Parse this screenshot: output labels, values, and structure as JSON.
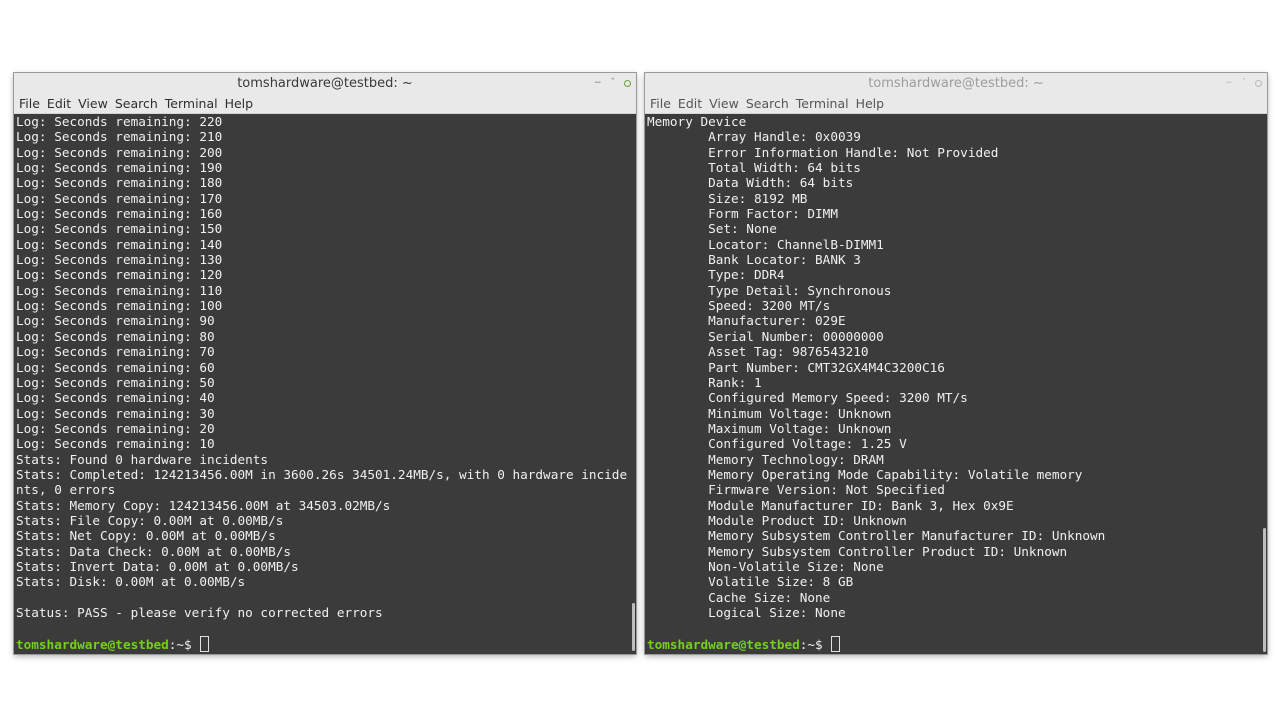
{
  "left_window": {
    "title": "tomshardware@testbed: ~",
    "menu": [
      "File",
      "Edit",
      "View",
      "Search",
      "Terminal",
      "Help"
    ],
    "lines": [
      "Log: Seconds remaining: 220",
      "Log: Seconds remaining: 210",
      "Log: Seconds remaining: 200",
      "Log: Seconds remaining: 190",
      "Log: Seconds remaining: 180",
      "Log: Seconds remaining: 170",
      "Log: Seconds remaining: 160",
      "Log: Seconds remaining: 150",
      "Log: Seconds remaining: 140",
      "Log: Seconds remaining: 130",
      "Log: Seconds remaining: 120",
      "Log: Seconds remaining: 110",
      "Log: Seconds remaining: 100",
      "Log: Seconds remaining: 90",
      "Log: Seconds remaining: 80",
      "Log: Seconds remaining: 70",
      "Log: Seconds remaining: 60",
      "Log: Seconds remaining: 50",
      "Log: Seconds remaining: 40",
      "Log: Seconds remaining: 30",
      "Log: Seconds remaining: 20",
      "Log: Seconds remaining: 10",
      "Stats: Found 0 hardware incidents",
      "Stats: Completed: 124213456.00M in 3600.26s 34501.24MB/s, with 0 hardware incide",
      "nts, 0 errors",
      "Stats: Memory Copy: 124213456.00M at 34503.02MB/s",
      "Stats: File Copy: 0.00M at 0.00MB/s",
      "Stats: Net Copy: 0.00M at 0.00MB/s",
      "Stats: Data Check: 0.00M at 0.00MB/s",
      "Stats: Invert Data: 0.00M at 0.00MB/s",
      "Stats: Disk: 0.00M at 0.00MB/s",
      "",
      "Status: PASS - please verify no corrected errors",
      ""
    ],
    "prompt_user": "tomshardware@testbed",
    "prompt_path": ":~$ "
  },
  "right_window": {
    "title": "tomshardware@testbed: ~",
    "menu": [
      "File",
      "Edit",
      "View",
      "Search",
      "Terminal",
      "Help"
    ],
    "lines": [
      "Memory Device",
      "        Array Handle: 0x0039",
      "        Error Information Handle: Not Provided",
      "        Total Width: 64 bits",
      "        Data Width: 64 bits",
      "        Size: 8192 MB",
      "        Form Factor: DIMM",
      "        Set: None",
      "        Locator: ChannelB-DIMM1",
      "        Bank Locator: BANK 3",
      "        Type: DDR4",
      "        Type Detail: Synchronous",
      "        Speed: 3200 MT/s",
      "        Manufacturer: 029E",
      "        Serial Number: 00000000",
      "        Asset Tag: 9876543210",
      "        Part Number: CMT32GX4M4C3200C16",
      "        Rank: 1",
      "        Configured Memory Speed: 3200 MT/s",
      "        Minimum Voltage: Unknown",
      "        Maximum Voltage: Unknown",
      "        Configured Voltage: 1.25 V",
      "        Memory Technology: DRAM",
      "        Memory Operating Mode Capability: Volatile memory",
      "        Firmware Version: Not Specified",
      "        Module Manufacturer ID: Bank 3, Hex 0x9E",
      "        Module Product ID: Unknown",
      "        Memory Subsystem Controller Manufacturer ID: Unknown",
      "        Memory Subsystem Controller Product ID: Unknown",
      "        Non-Volatile Size: None",
      "        Volatile Size: 8 GB",
      "        Cache Size: None",
      "        Logical Size: None",
      ""
    ],
    "prompt_user": "tomshardware@testbed",
    "prompt_path": ":~$ "
  },
  "colors": {
    "terminal_bg": "#3b3b3b",
    "terminal_fg": "#f0f0f0",
    "prompt_green": "#73d216",
    "chrome_bg": "#e9e9e9"
  },
  "icons": [
    "minimize-icon",
    "maximize-icon",
    "close-icon"
  ]
}
